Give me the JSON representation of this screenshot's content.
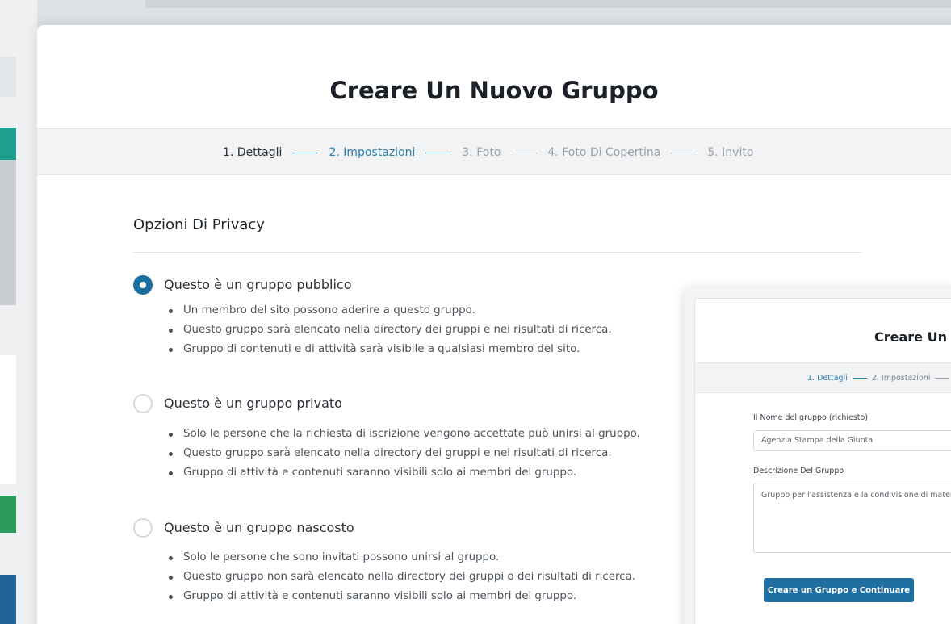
{
  "page": {
    "title": "Creare Un Nuovo Gruppo"
  },
  "steps": [
    {
      "label": "1. Dettagli"
    },
    {
      "label": "2. Impostazioni"
    },
    {
      "label": "3. Foto"
    },
    {
      "label": "4. Foto Di Copertina"
    },
    {
      "label": "5. Invito"
    }
  ],
  "privacy": {
    "heading": "Opzioni Di Privacy",
    "options": [
      {
        "label": "Questo è un gruppo pubblico",
        "selected": true,
        "bullets": [
          "Un membro del sito possono aderire a questo gruppo.",
          "Questo gruppo sarà elencato nella directory dei gruppi e nei risultati di ricerca.",
          "Gruppo di contenuti e di attività sarà visibile a qualsiasi membro del sito."
        ]
      },
      {
        "label": "Questo è un gruppo privato",
        "selected": false,
        "bullets": [
          "Solo le persone che la richiesta di iscrizione vengono accettate può unirsi al gruppo.",
          "Questo gruppo sarà elencato nella directory dei gruppi e nei risultati di ricerca.",
          "Gruppo di attività e contenuti saranno visibili solo ai membri del gruppo."
        ]
      },
      {
        "label": "Questo è un gruppo nascosto",
        "selected": false,
        "bullets": [
          "Solo le persone che sono invitati possono unirsi al gruppo.",
          "Questo gruppo non sarà elencato nella directory dei gruppi o dei risultati di ricerca.",
          "Gruppo di attività e contenuti saranno visibili solo ai membri del gruppo."
        ]
      }
    ]
  },
  "overlay": {
    "title": "Creare Un",
    "steps": [
      "1. Dettagli",
      "2. Impostazioni"
    ],
    "name_label": "Il Nome del gruppo (richiesto)",
    "name_value": "Agenzia Stampa della Giunta",
    "desc_label": "Descrizione Del Gruppo",
    "desc_value": "Gruppo per l'assistenza e la condivisione di mater",
    "submit_label": "Creare un Gruppo e Continuare"
  },
  "colors": {
    "accent": "#2b7fb0",
    "button": "#1f6fa3",
    "radio_selected": "#1c6e9e"
  }
}
